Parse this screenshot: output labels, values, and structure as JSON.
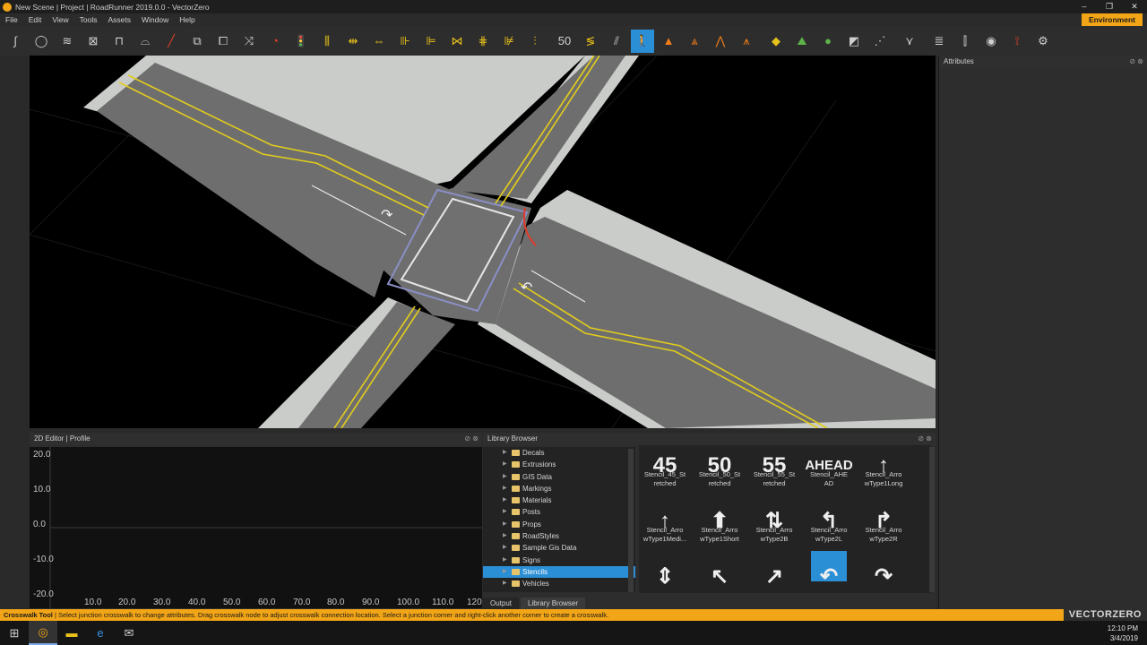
{
  "window": {
    "title": "New Scene | Project | RoadRunner 2019.0.0 - VectorZero",
    "controls": [
      "‒",
      "❐",
      "✕"
    ]
  },
  "menu": [
    "File",
    "Edit",
    "View",
    "Tools",
    "Assets",
    "Window",
    "Help"
  ],
  "environment_button": "Environment",
  "toolbar": {
    "tools": [
      {
        "icon": "road-plan-icon",
        "glyph": "∫"
      },
      {
        "icon": "circle-road-icon",
        "glyph": "◯"
      },
      {
        "icon": "road-style-icon",
        "glyph": "≋"
      },
      {
        "icon": "road-construction-icon",
        "glyph": "⊠"
      },
      {
        "icon": "lane-tool-icon",
        "glyph": "⊓"
      },
      {
        "icon": "lane-width-icon",
        "glyph": "⌓"
      },
      {
        "icon": "lane-marking-icon",
        "glyph": "╱"
      },
      {
        "icon": "lane-add-icon",
        "glyph": "⧉"
      },
      {
        "icon": "junction-icon",
        "glyph": "⧠"
      },
      {
        "icon": "maneuver-icon",
        "glyph": "⤨"
      },
      {
        "icon": "corner-icon",
        "glyph": "◔"
      },
      {
        "icon": "signal-icon",
        "glyph": "🚦"
      },
      {
        "icon": "lane-split-icon",
        "glyph": "⫼"
      },
      {
        "icon": "lane-carve-icon",
        "glyph": "⇹"
      },
      {
        "icon": "lane-form-icon",
        "glyph": "⇔"
      },
      {
        "icon": "lane-marking-1-icon",
        "glyph": "⊪"
      },
      {
        "icon": "lane-marking-2-icon",
        "glyph": "⊫"
      },
      {
        "icon": "lane-marking-3-icon",
        "glyph": "⋈"
      },
      {
        "icon": "lane-marking-4-icon",
        "glyph": "⋕"
      },
      {
        "icon": "lane-marking-5-icon",
        "glyph": "⊯"
      },
      {
        "icon": "lane-marking-6-icon",
        "glyph": "⫶"
      },
      {
        "icon": "speed-marking-icon",
        "glyph": "50"
      },
      {
        "icon": "curve-marking-icon",
        "glyph": "≶"
      },
      {
        "icon": "stripe-marking-icon",
        "glyph": "⫽"
      },
      {
        "icon": "crosswalk-icon",
        "glyph": "🚶",
        "selected": true
      },
      {
        "icon": "cone-icon",
        "glyph": "▲"
      },
      {
        "icon": "prop-set-icon",
        "glyph": "⩓"
      },
      {
        "icon": "prop-curve-icon",
        "glyph": "⋀"
      },
      {
        "icon": "prop-span-icon",
        "glyph": "⩚"
      },
      {
        "icon": "sign-icon",
        "glyph": "◆"
      },
      {
        "icon": "terrain-icon",
        "glyph": "⛰"
      },
      {
        "icon": "surface-icon",
        "glyph": "●"
      },
      {
        "icon": "elevation-map-icon",
        "glyph": "◩"
      },
      {
        "icon": "point-cloud-icon",
        "glyph": "⋰"
      },
      {
        "icon": "marking-point-icon",
        "glyph": "⋎"
      },
      {
        "icon": "layers-icon",
        "glyph": "≣"
      },
      {
        "icon": "bridge-icon",
        "glyph": "⫿"
      },
      {
        "icon": "camera-icon",
        "glyph": "◉"
      },
      {
        "icon": "scenario-icon",
        "glyph": "⟟"
      },
      {
        "icon": "world-settings-icon",
        "glyph": "⚙"
      }
    ]
  },
  "attributes_panel": {
    "title": "Attributes"
  },
  "editor_panel": {
    "title": "2D Editor | Profile",
    "y_ticks": [
      "20.0",
      "10.0",
      "0.0",
      "-10.0",
      "-20.0"
    ],
    "x_ticks": [
      "10.0",
      "20.0",
      "30.0",
      "40.0",
      "50.0",
      "60.0",
      "70.0",
      "80.0",
      "90.0",
      "100.0",
      "110.0",
      "120"
    ]
  },
  "library_browser": {
    "title": "Library Browser",
    "folders": [
      "Decals",
      "Extrusions",
      "GIS Data",
      "Markings",
      "Materials",
      "Posts",
      "Props",
      "RoadStyles",
      "Sample Gis Data",
      "Signs",
      "Stencils",
      "Vehicles"
    ],
    "selected_folder": "Stencils",
    "assets": [
      {
        "label": "Stencil_45_Stretched",
        "line1": "Stencil_45_St",
        "line2": "retched",
        "thumb": "45"
      },
      {
        "label": "Stencil_50_Stretched",
        "line1": "Stencil_50_St",
        "line2": "retched",
        "thumb": "50"
      },
      {
        "label": "Stencil_55_Stretched",
        "line1": "Stencil_55_St",
        "line2": "retched",
        "thumb": "55"
      },
      {
        "label": "Stencil_AHEAD",
        "line1": "Stencil_AHE",
        "line2": "AD",
        "thumb": "AHEAD"
      },
      {
        "label": "Stencil_ArrowType1Long",
        "line1": "Stencil_Arro",
        "line2": "wType1Long",
        "thumb": "↑"
      },
      {
        "label": "Stencil_ArrowType1Medium",
        "line1": "Stencil_Arro",
        "line2": "wType1Medi...",
        "thumb": "↑"
      },
      {
        "label": "Stencil_ArrowType1Short",
        "line1": "Stencil_Arro",
        "line2": "wType1Short",
        "thumb": "⬆"
      },
      {
        "label": "Stencil_ArrowType2B",
        "line1": "Stencil_Arro",
        "line2": "wType2B",
        "thumb": "⇅"
      },
      {
        "label": "Stencil_ArrowType2L",
        "line1": "Stencil_Arro",
        "line2": "wType2L",
        "thumb": "↰"
      },
      {
        "label": "Stencil_ArrowType2R",
        "line1": "Stencil_Arro",
        "line2": "wType2R",
        "thumb": "↱"
      },
      {
        "label": "",
        "line1": "",
        "line2": "",
        "thumb": "⇕"
      },
      {
        "label": "",
        "line1": "",
        "line2": "",
        "thumb": "↖"
      },
      {
        "label": "",
        "line1": "",
        "line2": "",
        "thumb": "↗"
      },
      {
        "label": "",
        "line1": "",
        "line2": "",
        "thumb": "↶",
        "selected": true
      },
      {
        "label": "",
        "line1": "",
        "line2": "",
        "thumb": "↷"
      }
    ],
    "tabs": [
      "Output",
      "Library Browser"
    ],
    "active_tab": "Library Browser"
  },
  "status_bar": {
    "tool": "Crosswalk Tool",
    "message": " | Select junction crosswalk to change attributes. Drag crosswalk node to adjust crosswalk connection location. Select a junction corner and right-click another corner to create a crosswalk.",
    "brand": "VECTORZERO"
  },
  "taskbar": {
    "time": "12:10 PM",
    "date": "3/4/2019",
    "apps": [
      "windows-start-icon",
      "roadrunner-app-icon",
      "file-explorer-icon",
      "edge-browser-icon",
      "mail-icon"
    ]
  },
  "colors": {
    "accent": "#f2a516",
    "selection": "#2b8fd6",
    "road": "#6e6e6e",
    "sidewalk": "#c9ccc8",
    "lane_yellow": "#e2cc1c"
  }
}
